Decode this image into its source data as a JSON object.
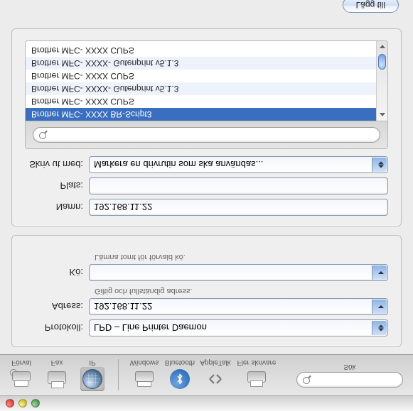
{
  "titlebar": {},
  "toolbar": {
    "items": [
      {
        "key": "forval",
        "label": "Förval"
      },
      {
        "key": "fax",
        "label": "Fax"
      },
      {
        "key": "ip",
        "label": "IP"
      },
      {
        "key": "windows",
        "label": "Windows"
      },
      {
        "key": "bluetooth",
        "label": "Bluetooth"
      },
      {
        "key": "appletalk",
        "label": "AppleTalk"
      },
      {
        "key": "fler",
        "label": "Fler skrivare"
      }
    ],
    "search_label": "Sök",
    "search_placeholder": ""
  },
  "form1": {
    "protokoll_label": "Protokoll:",
    "protokoll_value": "LPD – Line Printer Daemon",
    "adress_label": "Adress:",
    "adress_value": "192.168.11.22",
    "adress_hint": "Giltig och fullständig adress.",
    "ko_label": "Kö:",
    "ko_value": "",
    "ko_hint": "Lämna tomt för förvald kö."
  },
  "form2": {
    "namn_label": "Namn:",
    "namn_value": "192.168.11.22",
    "plats_label": "Plats:",
    "plats_value": "",
    "skrivut_label": "Skriv ut med:",
    "skrivut_value": "Markera en drivrutin som ska användas...",
    "driver_search_placeholder": "",
    "drivers": [
      {
        "name": "Brother MFC- XXXX BR-Script3",
        "selected": true
      },
      {
        "name": "Brother MFC- XXXX CUPS"
      },
      {
        "name": "Brother MFC- XXXX- Gutenprint v5.1.3"
      },
      {
        "name": "Brother MFC- XXXX CUPS"
      },
      {
        "name": "Brother MFC- XXXX- Gutenprint v5.1.3"
      },
      {
        "name": "Brother MFC- XXXX CUPS"
      }
    ]
  },
  "footer": {
    "add_button": "Lägg till"
  }
}
